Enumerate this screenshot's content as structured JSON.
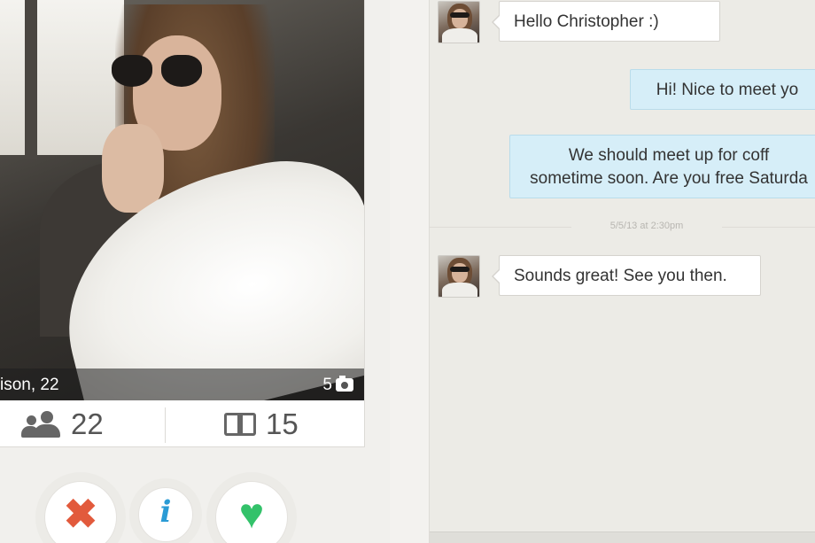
{
  "profile": {
    "caption_name": "ison, 22",
    "photo_count": "5",
    "stats": {
      "friends_count": "22",
      "interests_count": "15"
    },
    "actions": {
      "nope_icon": "x-icon",
      "info_label": "i",
      "like_icon": "heart-icon"
    }
  },
  "chat": {
    "messages": [
      {
        "direction": "incoming",
        "text": "Hello Christopher :)"
      },
      {
        "direction": "outgoing",
        "text": "Hi! Nice to meet yo"
      },
      {
        "direction": "outgoing",
        "line1": "We should meet up for coff",
        "line2": "sometime soon. Are you free Saturda"
      },
      {
        "direction": "incoming",
        "text": "Sounds great! See you then."
      }
    ],
    "timestamp": "5/5/13 at 2:30pm"
  },
  "colors": {
    "nope": "#e25a3c",
    "info": "#2a9bd5",
    "like": "#33c26a",
    "outgoing_bubble": "#d6eef8"
  }
}
